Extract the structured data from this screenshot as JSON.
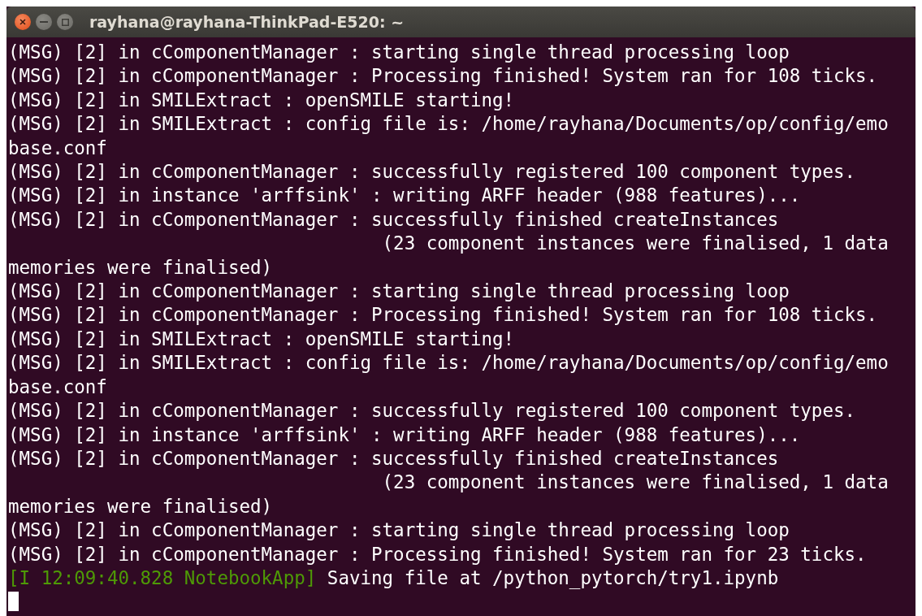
{
  "window": {
    "title": "rayhana@rayhana-ThinkPad-E520: ~"
  },
  "terminal": {
    "lines": [
      {
        "kind": "plain",
        "text": "(MSG) [2] in cComponentManager : starting single thread processing loop"
      },
      {
        "kind": "plain",
        "text": "(MSG) [2] in cComponentManager : Processing finished! System ran for 108 ticks."
      },
      {
        "kind": "plain",
        "text": "(MSG) [2] in SMILExtract : openSMILE starting!"
      },
      {
        "kind": "plain",
        "text": "(MSG) [2] in SMILExtract : config file is: /home/rayhana/Documents/op/config/emo"
      },
      {
        "kind": "plain",
        "text": "base.conf"
      },
      {
        "kind": "plain",
        "text": "(MSG) [2] in cComponentManager : successfully registered 100 component types."
      },
      {
        "kind": "plain",
        "text": "(MSG) [2] in instance 'arffsink' : writing ARFF header (988 features)..."
      },
      {
        "kind": "plain",
        "text": "(MSG) [2] in cComponentManager : successfully finished createInstances"
      },
      {
        "kind": "plain",
        "text": "                                  (23 component instances were finalised, 1 data"
      },
      {
        "kind": "plain",
        "text": "memories were finalised)"
      },
      {
        "kind": "plain",
        "text": "(MSG) [2] in cComponentManager : starting single thread processing loop"
      },
      {
        "kind": "plain",
        "text": "(MSG) [2] in cComponentManager : Processing finished! System ran for 108 ticks."
      },
      {
        "kind": "plain",
        "text": "(MSG) [2] in SMILExtract : openSMILE starting!"
      },
      {
        "kind": "plain",
        "text": "(MSG) [2] in SMILExtract : config file is: /home/rayhana/Documents/op/config/emo"
      },
      {
        "kind": "plain",
        "text": "base.conf"
      },
      {
        "kind": "plain",
        "text": "(MSG) [2] in cComponentManager : successfully registered 100 component types."
      },
      {
        "kind": "plain",
        "text": "(MSG) [2] in instance 'arffsink' : writing ARFF header (988 features)..."
      },
      {
        "kind": "plain",
        "text": "(MSG) [2] in cComponentManager : successfully finished createInstances"
      },
      {
        "kind": "plain",
        "text": "                                  (23 component instances were finalised, 1 data"
      },
      {
        "kind": "plain",
        "text": "memories were finalised)"
      },
      {
        "kind": "plain",
        "text": "(MSG) [2] in cComponentManager : starting single thread processing loop"
      },
      {
        "kind": "plain",
        "text": "(MSG) [2] in cComponentManager : Processing finished! System ran for 23 ticks."
      },
      {
        "kind": "log",
        "prefix": "[I 12:09:40.828 NotebookApp]",
        "text": " Saving file at /python_pytorch/try1.ipynb"
      }
    ]
  }
}
